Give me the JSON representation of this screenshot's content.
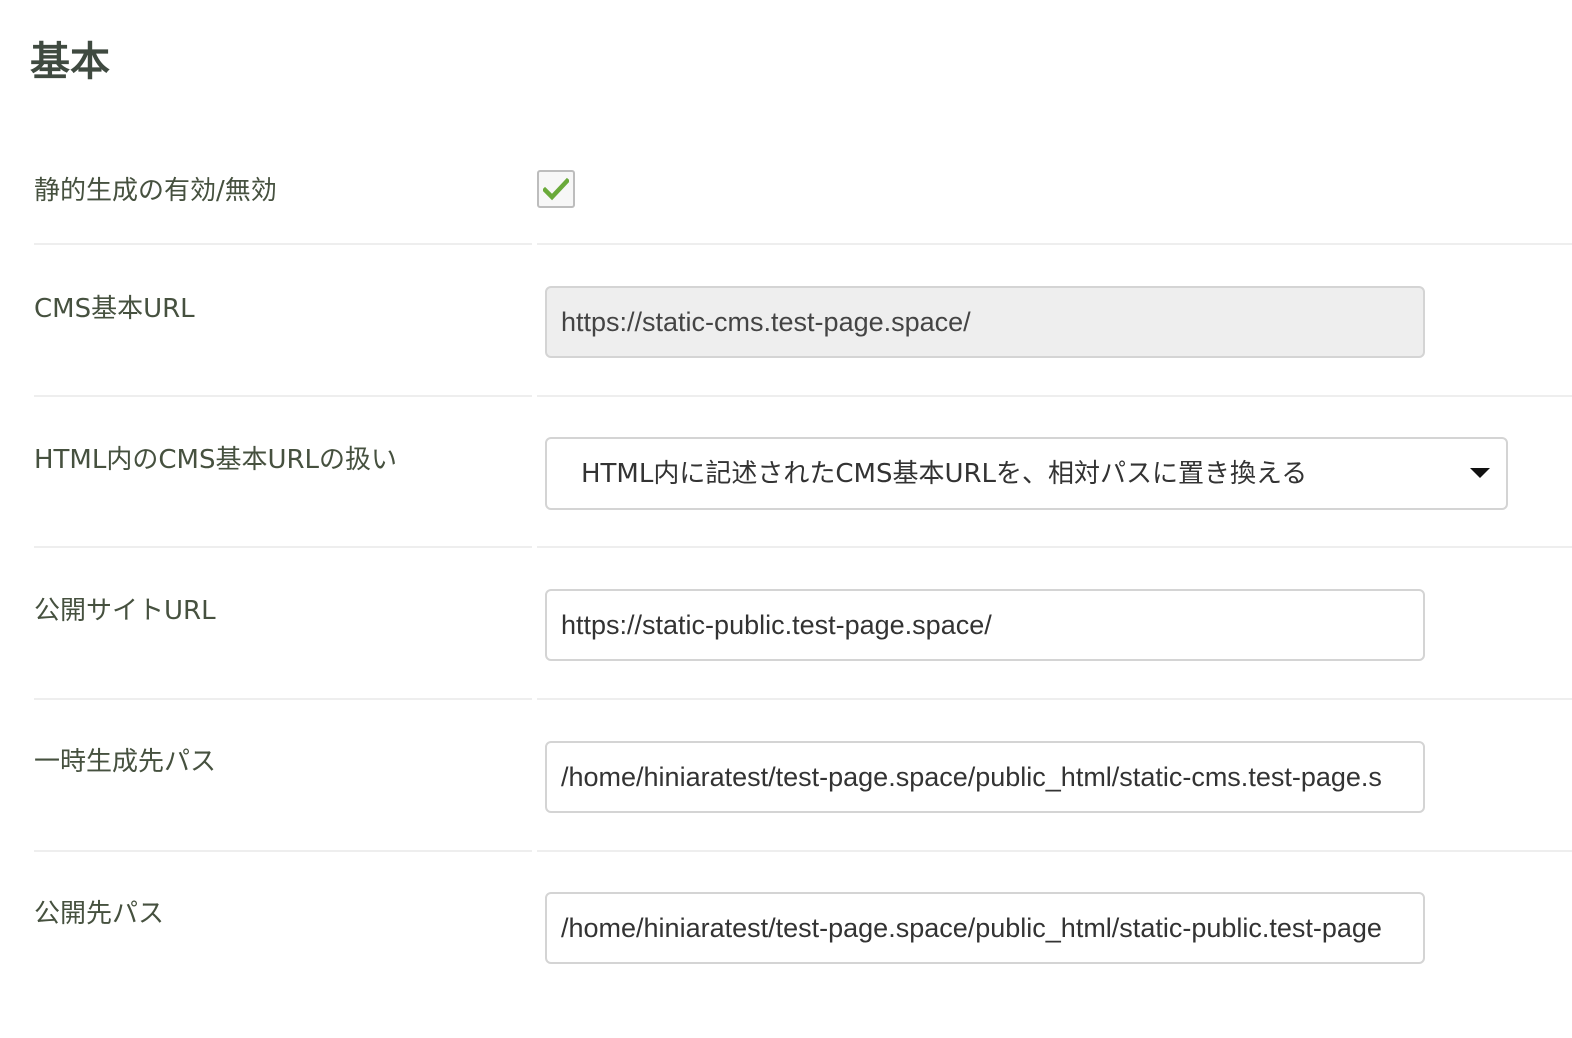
{
  "section": {
    "title": "基本"
  },
  "fields": {
    "static_generation": {
      "label": "静的生成の有効/無効",
      "checked": true
    },
    "cms_base_url": {
      "label": "CMS基本URL",
      "value": "https://static-cms.test-page.space/"
    },
    "cms_url_handling": {
      "label": "HTML内のCMS基本URLの扱い",
      "selected": "HTML内に記述されたCMS基本URLを、相対パスに置き換える"
    },
    "public_site_url": {
      "label": "公開サイトURL",
      "value": "https://static-public.test-page.space/"
    },
    "temp_output_path": {
      "label": "一時生成先パス",
      "value": "/home/hiniaratest/test-page.space/public_html/static-cms.test-page.s"
    },
    "publish_path": {
      "label": "公開先パス",
      "value": "/home/hiniaratest/test-page.space/public_html/static-public.test-page"
    }
  },
  "colors": {
    "check_mark": "#6aaa3a",
    "label_text": "#46513f",
    "readonly_bg": "#eeeeee",
    "border": "#d4d4d4"
  },
  "icons": {
    "checkbox": "check-icon",
    "select": "caret-down-icon"
  }
}
